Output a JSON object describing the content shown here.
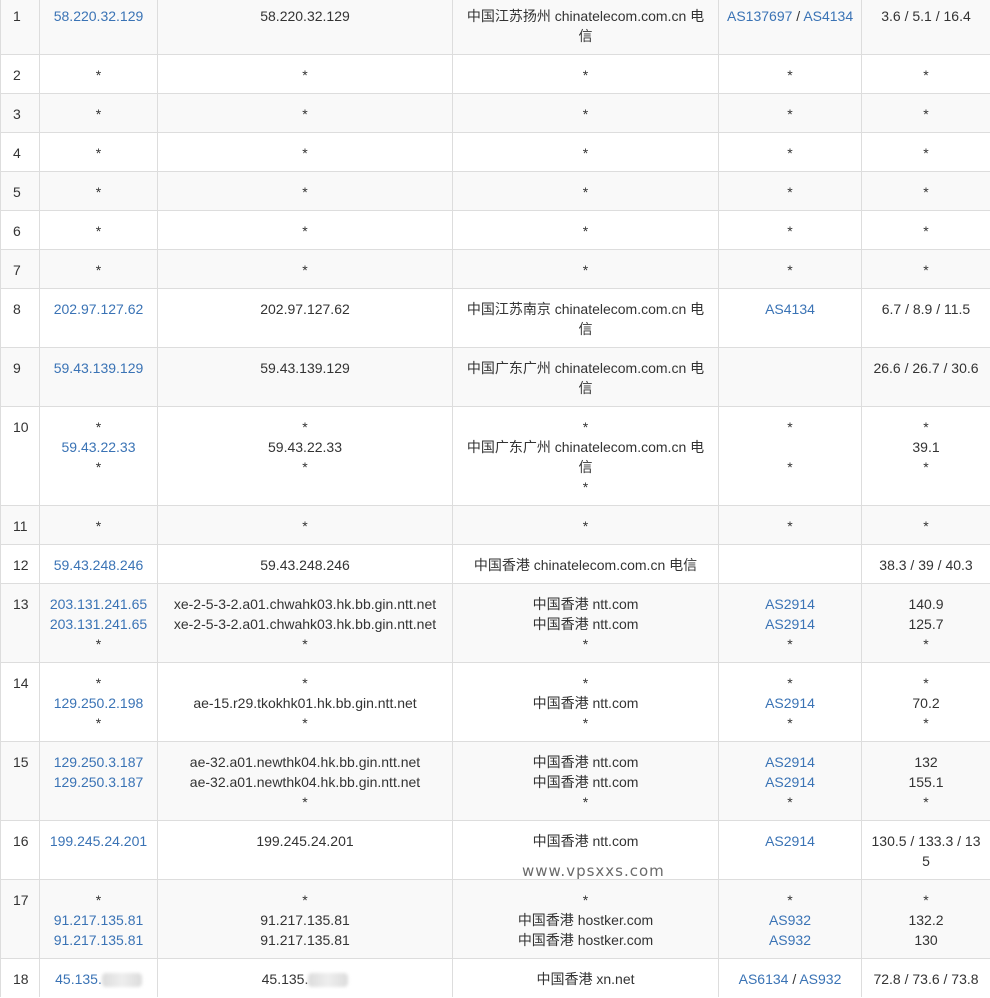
{
  "rows": [
    {
      "hop": "1",
      "ips": [
        "58.220.32.129"
      ],
      "hosts": [
        "58.220.32.129"
      ],
      "geos": [
        "中国江苏扬州 chinatelecom.com.cn 电信"
      ],
      "asns": [
        [
          "AS137697",
          "AS4134"
        ]
      ],
      "rtts": [
        "3.6 / 5.1 / 16.4"
      ]
    },
    {
      "hop": "2",
      "ips": [
        "*"
      ],
      "hosts": [
        "*"
      ],
      "geos": [
        "*"
      ],
      "asns": [
        [
          "*"
        ]
      ],
      "rtts": [
        "*"
      ]
    },
    {
      "hop": "3",
      "ips": [
        "*"
      ],
      "hosts": [
        "*"
      ],
      "geos": [
        "*"
      ],
      "asns": [
        [
          "*"
        ]
      ],
      "rtts": [
        "*"
      ]
    },
    {
      "hop": "4",
      "ips": [
        "*"
      ],
      "hosts": [
        "*"
      ],
      "geos": [
        "*"
      ],
      "asns": [
        [
          "*"
        ]
      ],
      "rtts": [
        "*"
      ]
    },
    {
      "hop": "5",
      "ips": [
        "*"
      ],
      "hosts": [
        "*"
      ],
      "geos": [
        "*"
      ],
      "asns": [
        [
          "*"
        ]
      ],
      "rtts": [
        "*"
      ]
    },
    {
      "hop": "6",
      "ips": [
        "*"
      ],
      "hosts": [
        "*"
      ],
      "geos": [
        "*"
      ],
      "asns": [
        [
          "*"
        ]
      ],
      "rtts": [
        "*"
      ]
    },
    {
      "hop": "7",
      "ips": [
        "*"
      ],
      "hosts": [
        "*"
      ],
      "geos": [
        "*"
      ],
      "asns": [
        [
          "*"
        ]
      ],
      "rtts": [
        "*"
      ]
    },
    {
      "hop": "8",
      "ips": [
        "202.97.127.62"
      ],
      "hosts": [
        "202.97.127.62"
      ],
      "geos": [
        "中国江苏南京 chinatelecom.com.cn 电信"
      ],
      "asns": [
        [
          "AS4134"
        ]
      ],
      "rtts": [
        "6.7 / 8.9 / 11.5"
      ]
    },
    {
      "hop": "9",
      "ips": [
        "59.43.139.129"
      ],
      "hosts": [
        "59.43.139.129"
      ],
      "geos": [
        "中国广东广州 chinatelecom.com.cn 电信"
      ],
      "asns": [
        []
      ],
      "rtts": [
        "26.6 / 26.7 / 30.6"
      ]
    },
    {
      "hop": "10",
      "ips": [
        "*",
        "59.43.22.33",
        "*"
      ],
      "hosts": [
        "*",
        "59.43.22.33",
        "*"
      ],
      "geos": [
        "*",
        "中国广东广州 chinatelecom.com.cn 电信",
        "*"
      ],
      "asns": [
        [
          "*"
        ],
        [],
        [
          "*"
        ]
      ],
      "rtts": [
        "*",
        "39.1",
        "*"
      ]
    },
    {
      "hop": "11",
      "ips": [
        "*"
      ],
      "hosts": [
        "*"
      ],
      "geos": [
        "*"
      ],
      "asns": [
        [
          "*"
        ]
      ],
      "rtts": [
        "*"
      ]
    },
    {
      "hop": "12",
      "ips": [
        "59.43.248.246"
      ],
      "hosts": [
        "59.43.248.246"
      ],
      "geos": [
        "中国香港 chinatelecom.com.cn 电信"
      ],
      "asns": [
        []
      ],
      "rtts": [
        "38.3 / 39 / 40.3"
      ]
    },
    {
      "hop": "13",
      "ips": [
        "203.131.241.65",
        "203.131.241.65",
        "*"
      ],
      "hosts": [
        "xe-2-5-3-2.a01.chwahk03.hk.bb.gin.ntt.net",
        "xe-2-5-3-2.a01.chwahk03.hk.bb.gin.ntt.net",
        "*"
      ],
      "geos": [
        "中国香港 ntt.com",
        "中国香港 ntt.com",
        "*"
      ],
      "asns": [
        [
          "AS2914"
        ],
        [
          "AS2914"
        ],
        [
          "*"
        ]
      ],
      "rtts": [
        "140.9",
        "125.7",
        "*"
      ]
    },
    {
      "hop": "14",
      "ips": [
        "*",
        "129.250.2.198",
        "*"
      ],
      "hosts": [
        "*",
        "ae-15.r29.tkokhk01.hk.bb.gin.ntt.net",
        "*"
      ],
      "geos": [
        "*",
        "中国香港 ntt.com",
        "*"
      ],
      "asns": [
        [
          "*"
        ],
        [
          "AS2914"
        ],
        [
          "*"
        ]
      ],
      "rtts": [
        "*",
        "70.2",
        "*"
      ]
    },
    {
      "hop": "15",
      "ips": [
        "129.250.3.187",
        "129.250.3.187"
      ],
      "hosts": [
        "ae-32.a01.newthk04.hk.bb.gin.ntt.net",
        "ae-32.a01.newthk04.hk.bb.gin.ntt.net",
        "*"
      ],
      "geos": [
        "中国香港 ntt.com",
        "中国香港 ntt.com",
        "*"
      ],
      "asns": [
        [
          "AS2914"
        ],
        [
          "AS2914"
        ],
        [
          "*"
        ]
      ],
      "rtts": [
        "132",
        "155.1",
        "*"
      ]
    },
    {
      "hop": "16",
      "ips": [
        "199.245.24.201"
      ],
      "hosts": [
        "199.245.24.201"
      ],
      "geos": [
        "中国香港 ntt.com"
      ],
      "asns": [
        [
          "AS2914"
        ]
      ],
      "rtts": [
        "130.5 / 133.3 / 135"
      ]
    },
    {
      "hop": "17",
      "ips": [
        "*",
        "91.217.135.81",
        "91.217.135.81"
      ],
      "hosts": [
        "*",
        "91.217.135.81",
        "91.217.135.81"
      ],
      "geos": [
        "*",
        "中国香港 hostker.com",
        "中国香港 hostker.com"
      ],
      "asns": [
        [
          "*"
        ],
        [
          "AS932"
        ],
        [
          "AS932"
        ]
      ],
      "rtts": [
        "*",
        "132.2",
        "130"
      ]
    },
    {
      "hop": "18",
      "ips": [
        "45.135."
      ],
      "hosts": [
        "45.135."
      ],
      "geos": [
        "中国香港 xn.net"
      ],
      "asns": [
        [
          "AS6134",
          "AS932"
        ]
      ],
      "rtts": [
        "72.8 / 73.6 / 73.8"
      ]
    }
  ],
  "watermark": "www.vpsxxs.com",
  "colors": {
    "link": "#3a73b5",
    "text": "#333333",
    "border": "#dddddd",
    "stripe": "#f9f9f9"
  }
}
